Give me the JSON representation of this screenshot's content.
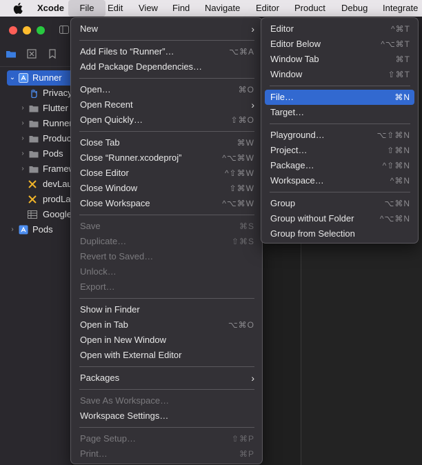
{
  "menubar": {
    "app_name": "Xcode",
    "items": [
      "File",
      "Edit",
      "View",
      "Find",
      "Navigate",
      "Editor",
      "Product",
      "Debug",
      "Integrate"
    ]
  },
  "sidebar": {
    "tree": [
      {
        "label": "Runner",
        "icon": "xcode-project-icon",
        "expanded": true
      },
      {
        "label": "Privacy",
        "icon": "hand-icon"
      },
      {
        "label": "Flutter",
        "icon": "folder-icon"
      },
      {
        "label": "Runner",
        "icon": "folder-icon"
      },
      {
        "label": "Products",
        "icon": "folder-icon"
      },
      {
        "label": "Pods",
        "icon": "folder-icon"
      },
      {
        "label": "Frameworks",
        "icon": "folder-icon"
      },
      {
        "label": "devLaunch",
        "icon": "config-icon"
      },
      {
        "label": "prodLaunch",
        "icon": "config-icon"
      },
      {
        "label": "GoogleService",
        "icon": "plist-icon"
      },
      {
        "label": "Pods",
        "icon": "xcode-project-icon"
      }
    ]
  },
  "file_menu": {
    "new": {
      "label": "New"
    },
    "add_files": {
      "label": "Add Files to “Runner”…",
      "shortcut": "⌥⌘A"
    },
    "add_packages": {
      "label": "Add Package Dependencies…"
    },
    "open": {
      "label": "Open…",
      "shortcut": "⌘O"
    },
    "open_recent": {
      "label": "Open Recent"
    },
    "open_quickly": {
      "label": "Open Quickly…",
      "shortcut": "⇧⌘O"
    },
    "close_tab": {
      "label": "Close Tab",
      "shortcut": "⌘W"
    },
    "close_project": {
      "label": "Close “Runner.xcodeproj”",
      "shortcut": "^⌥⌘W"
    },
    "close_editor": {
      "label": "Close Editor",
      "shortcut": "^⇧⌘W"
    },
    "close_window": {
      "label": "Close Window",
      "shortcut": "⇧⌘W"
    },
    "close_workspace": {
      "label": "Close Workspace",
      "shortcut": "^⌥⌘W"
    },
    "save": {
      "label": "Save",
      "shortcut": "⌘S"
    },
    "duplicate": {
      "label": "Duplicate…",
      "shortcut": "⇧⌘S"
    },
    "revert": {
      "label": "Revert to Saved…"
    },
    "unlock": {
      "label": "Unlock…"
    },
    "export": {
      "label": "Export…"
    },
    "show_in_finder": {
      "label": "Show in Finder"
    },
    "open_in_tab": {
      "label": "Open in Tab",
      "shortcut": "⌥⌘O"
    },
    "open_new_window": {
      "label": "Open in New Window"
    },
    "open_external": {
      "label": "Open with External Editor"
    },
    "packages": {
      "label": "Packages"
    },
    "save_as_workspace": {
      "label": "Save As Workspace…"
    },
    "workspace_settings": {
      "label": "Workspace Settings…"
    },
    "page_setup": {
      "label": "Page Setup…",
      "shortcut": "⇧⌘P"
    },
    "print": {
      "label": "Print…",
      "shortcut": "⌘P"
    }
  },
  "new_submenu": {
    "editor": {
      "label": "Editor",
      "shortcut": "^⌘T"
    },
    "editor_below": {
      "label": "Editor Below",
      "shortcut": "^⌥⌘T"
    },
    "window_tab": {
      "label": "Window Tab",
      "shortcut": "⌘T"
    },
    "window": {
      "label": "Window",
      "shortcut": "⇧⌘T"
    },
    "file": {
      "label": "File…",
      "shortcut": "⌘N"
    },
    "target": {
      "label": "Target…"
    },
    "playground": {
      "label": "Playground…",
      "shortcut": "⌥⇧⌘N"
    },
    "project": {
      "label": "Project…",
      "shortcut": "⇧⌘N"
    },
    "package": {
      "label": "Package…",
      "shortcut": "^⇧⌘N"
    },
    "workspace": {
      "label": "Workspace…",
      "shortcut": "^⌘N"
    },
    "group": {
      "label": "Group",
      "shortcut": "⌥⌘N"
    },
    "group_without_folder": {
      "label": "Group without Folder",
      "shortcut": "^⌥⌘N"
    },
    "group_from_selection": {
      "label": "Group from Selection"
    }
  },
  "colors": {
    "highlight": "#3269d0",
    "selection": "#2e63c9",
    "menu_bg": "#343237",
    "menubar_bg": "#e9e6ea"
  }
}
